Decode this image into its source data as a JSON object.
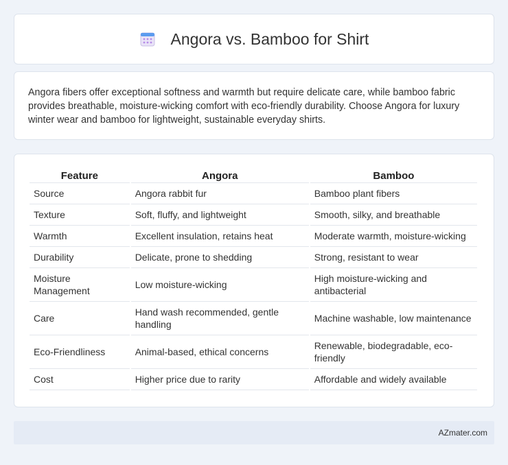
{
  "header": {
    "title": "Angora vs. Bamboo for Shirt",
    "icon": "calendar-icon"
  },
  "intro": {
    "text": "Angora fibers offer exceptional softness and warmth but require delicate care, while bamboo fabric provides breathable, moisture-wicking comfort with eco-friendly durability. Choose Angora for luxury winter wear and bamboo for lightweight, sustainable everyday shirts."
  },
  "table": {
    "headers": [
      "Feature",
      "Angora",
      "Bamboo"
    ],
    "rows": [
      [
        "Source",
        "Angora rabbit fur",
        "Bamboo plant fibers"
      ],
      [
        "Texture",
        "Soft, fluffy, and lightweight",
        "Smooth, silky, and breathable"
      ],
      [
        "Warmth",
        "Excellent insulation, retains heat",
        "Moderate warmth, moisture-wicking"
      ],
      [
        "Durability",
        "Delicate, prone to shedding",
        "Strong, resistant to wear"
      ],
      [
        "Moisture Management",
        "Low moisture-wicking",
        "High moisture-wicking and antibacterial"
      ],
      [
        "Care",
        "Hand wash recommended, gentle handling",
        "Machine washable, low maintenance"
      ],
      [
        "Eco-Friendliness",
        "Animal-based, ethical concerns",
        "Renewable, biodegradable, eco-friendly"
      ],
      [
        "Cost",
        "Higher price due to rarity",
        "Affordable and widely available"
      ]
    ]
  },
  "footer": {
    "site": "AZmater.com"
  }
}
